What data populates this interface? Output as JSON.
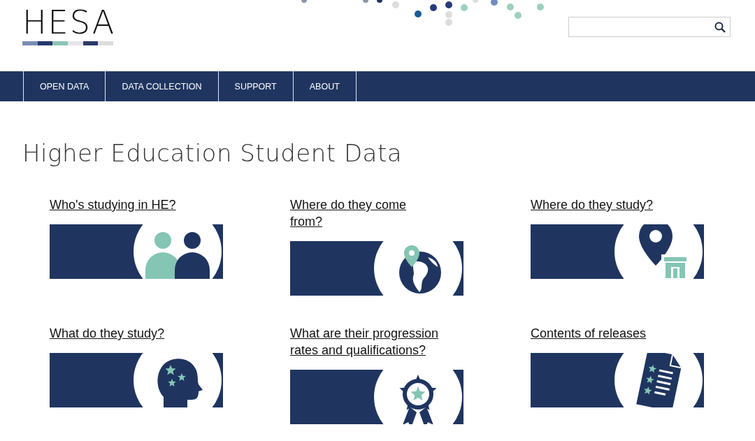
{
  "logo": {
    "text": "HESA"
  },
  "nav": [
    {
      "label": "OPEN DATA"
    },
    {
      "label": "DATA COLLECTION"
    },
    {
      "label": "SUPPORT"
    },
    {
      "label": "ABOUT"
    }
  ],
  "heading": "Higher Education Student Data",
  "cards": [
    {
      "title": "Who's studying in HE?",
      "kind": "people"
    },
    {
      "title": "Where do they come from?",
      "kind": "globe"
    },
    {
      "title": "Where do they study?",
      "kind": "campus"
    },
    {
      "title": "What do they study?",
      "kind": "head"
    },
    {
      "title": "What are their progression rates and qualifications?",
      "kind": "rosette"
    },
    {
      "title": "Contents of releases",
      "kind": "document"
    }
  ]
}
